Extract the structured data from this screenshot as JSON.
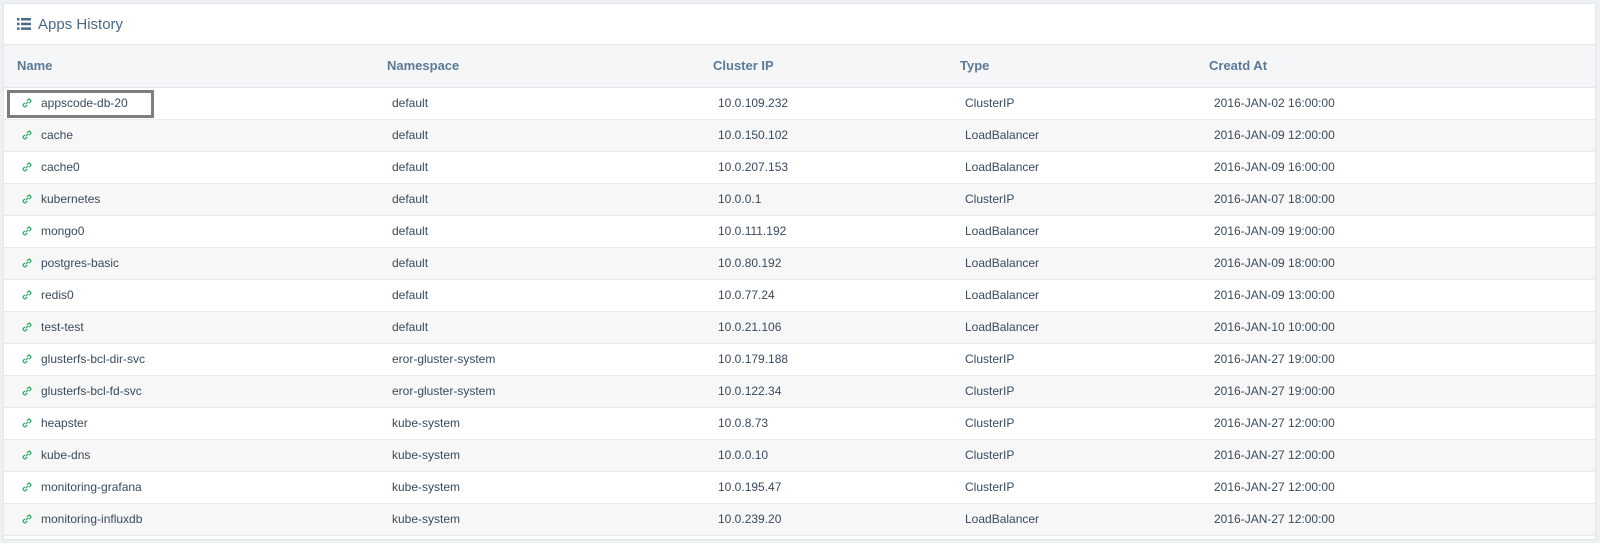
{
  "panel": {
    "title": "Apps History",
    "icon": "list-icon"
  },
  "table": {
    "columns": [
      "Name",
      "Namespace",
      "Cluster IP",
      "Type",
      "Creatd At"
    ],
    "rows": [
      {
        "name": "appscode-db-20",
        "namespace": "default",
        "cluster_ip": "10.0.109.232",
        "type": "ClusterIP",
        "created_at": "2016-JAN-02 16:00:00"
      },
      {
        "name": "cache",
        "namespace": "default",
        "cluster_ip": "10.0.150.102",
        "type": "LoadBalancer",
        "created_at": "2016-JAN-09 12:00:00"
      },
      {
        "name": "cache0",
        "namespace": "default",
        "cluster_ip": "10.0.207.153",
        "type": "LoadBalancer",
        "created_at": "2016-JAN-09 16:00:00"
      },
      {
        "name": "kubernetes",
        "namespace": "default",
        "cluster_ip": "10.0.0.1",
        "type": "ClusterIP",
        "created_at": "2016-JAN-07 18:00:00"
      },
      {
        "name": "mongo0",
        "namespace": "default",
        "cluster_ip": "10.0.111.192",
        "type": "LoadBalancer",
        "created_at": "2016-JAN-09 19:00:00"
      },
      {
        "name": "postgres-basic",
        "namespace": "default",
        "cluster_ip": "10.0.80.192",
        "type": "LoadBalancer",
        "created_at": "2016-JAN-09 18:00:00"
      },
      {
        "name": "redis0",
        "namespace": "default",
        "cluster_ip": "10.0.77.24",
        "type": "LoadBalancer",
        "created_at": "2016-JAN-09 13:00:00"
      },
      {
        "name": "test-test",
        "namespace": "default",
        "cluster_ip": "10.0.21.106",
        "type": "LoadBalancer",
        "created_at": "2016-JAN-10 10:00:00"
      },
      {
        "name": "glusterfs-bcl-dir-svc",
        "namespace": "eror-gluster-system",
        "cluster_ip": "10.0.179.188",
        "type": "ClusterIP",
        "created_at": "2016-JAN-27 19:00:00"
      },
      {
        "name": "glusterfs-bcl-fd-svc",
        "namespace": "eror-gluster-system",
        "cluster_ip": "10.0.122.34",
        "type": "ClusterIP",
        "created_at": "2016-JAN-27 19:00:00"
      },
      {
        "name": "heapster",
        "namespace": "kube-system",
        "cluster_ip": "10.0.8.73",
        "type": "ClusterIP",
        "created_at": "2016-JAN-27 12:00:00"
      },
      {
        "name": "kube-dns",
        "namespace": "kube-system",
        "cluster_ip": "10.0.0.10",
        "type": "ClusterIP",
        "created_at": "2016-JAN-27 12:00:00"
      },
      {
        "name": "monitoring-grafana",
        "namespace": "kube-system",
        "cluster_ip": "10.0.195.47",
        "type": "ClusterIP",
        "created_at": "2016-JAN-27 12:00:00"
      },
      {
        "name": "monitoring-influxdb",
        "namespace": "kube-system",
        "cluster_ip": "10.0.239.20",
        "type": "LoadBalancer",
        "created_at": "2016-JAN-27 12:00:00"
      }
    ],
    "row_icon": "link-icon",
    "selected_row": 0
  },
  "colors": {
    "link_icon": "#2eaa6e",
    "header_text": "#5b7a94",
    "title_text": "#4a6a85",
    "selection_border": "#7d7d7d"
  }
}
